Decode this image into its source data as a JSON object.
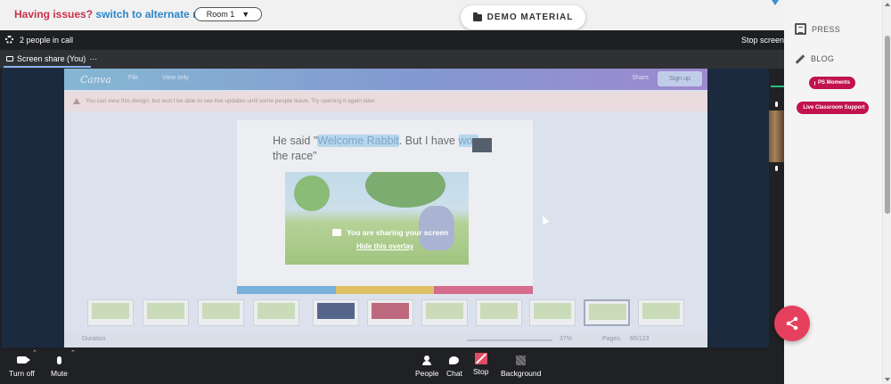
{
  "topbar": {
    "issues_text": "Having issues?",
    "alternate_link": "switch to alternate room",
    "room_select": "Room 1",
    "room_caret": "▼",
    "demo_button": "DEMO MATERIAL"
  },
  "right_panel": {
    "press": "PRESS",
    "blog": "BLOG",
    "ps_moments": "PS Moments",
    "live_support": "Live Classroom Support"
  },
  "call": {
    "people_in_call": "2 people in call",
    "stop_screen": "Stop screen",
    "share_tab_label": "Screen share (You)",
    "share_tab_more": "···"
  },
  "canva": {
    "logo": "Canva",
    "menu_file": "File",
    "menu_view": "View only",
    "share": "Share",
    "signup": "Sign up",
    "notice": "You can view this design, but won't be able to see live updates until some people leave. Try opening it again later.",
    "slide_text_1": "He said \"",
    "slide_hl_1": "Welcome Rabbit",
    "slide_text_2": ". But I have ",
    "slide_hl_2": "won",
    "slide_text_3": "the race\"",
    "duration": "Duration",
    "zoom": "37%",
    "pages": "Pages",
    "page_count": "66/123",
    "slide_bar_colors": [
      "#5aa0d6",
      "#e0b53a",
      "#d1466a"
    ]
  },
  "overlay": {
    "sharing_message": "You are sharing your screen",
    "hide_overlay": "Hide this overlay"
  },
  "controls": {
    "turn_off": "Turn off",
    "mute": "Mute",
    "people": "People",
    "chat": "Chat",
    "stop": "Stop",
    "background": "Background"
  },
  "colors": {
    "accent_pink": "#e5405e",
    "pill_red": "#c2134f",
    "link_blue": "#2c86c7",
    "issue_red": "#c9314a"
  }
}
